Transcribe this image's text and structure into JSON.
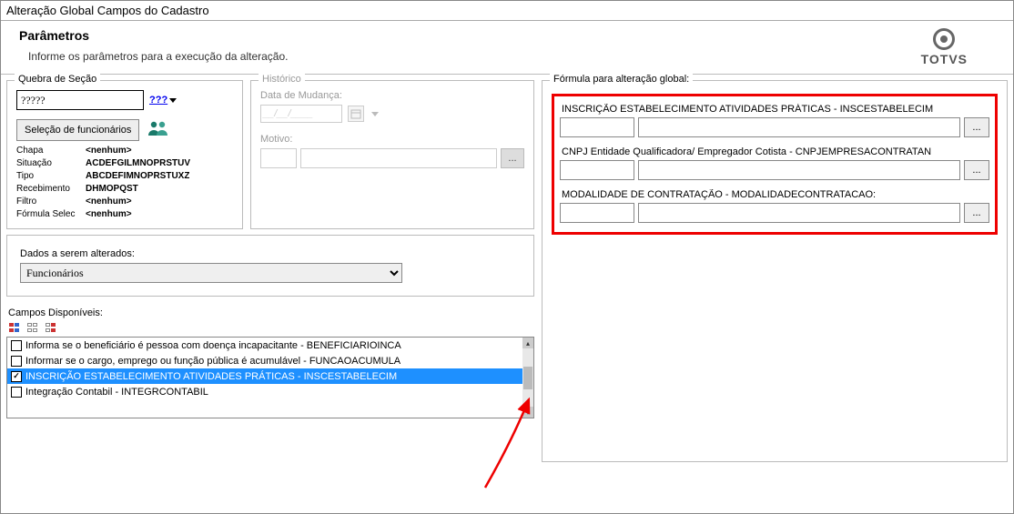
{
  "window": {
    "title": "Alteração Global Campos do Cadastro"
  },
  "header": {
    "title": "Parâmetros",
    "subtitle": "Informe os parâmetros para a execução da alteração.",
    "brand": "TOTVS"
  },
  "quebra": {
    "group_label": "Quebra de Seção",
    "value": "?????",
    "help_text": "???",
    "sel_button": "Seleção de funcionários",
    "filters": [
      {
        "label": "Chapa",
        "value": "<nenhum>"
      },
      {
        "label": "Situação",
        "value": "ACDEFGILMNOPRSTUV"
      },
      {
        "label": "Tipo",
        "value": "ABCDEFIMNOPRSTUXZ"
      },
      {
        "label": "Recebimento",
        "value": "DHMOPQST"
      },
      {
        "label": "Filtro",
        "value": "<nenhum>"
      },
      {
        "label": "Fórmula Selec",
        "value": "<nenhum>"
      }
    ]
  },
  "historico": {
    "group_label": "Histórico",
    "data_label": "Data de Mudança:",
    "data_placeholder": "__/__/____",
    "motivo_label": "Motivo:",
    "browse": "..."
  },
  "dados": {
    "label": "Dados a serem alterados:",
    "selected": "Funcionários"
  },
  "campos": {
    "label": "Campos Disponíveis:",
    "items": [
      {
        "checked": false,
        "text": "Informa se o beneficiário é pessoa com doença incapacitante - BENEFICIARIOINCA"
      },
      {
        "checked": false,
        "text": "Informar se o cargo, emprego ou função pública é acumulável - FUNCAOACUMULA"
      },
      {
        "checked": true,
        "selected": true,
        "text": "INSCRIÇÃO ESTABELECIMENTO ATIVIDADES PRÁTICAS - INSCESTABELECIM"
      },
      {
        "checked": false,
        "text": "Integração Contabil - INTEGRCONTABIL"
      }
    ]
  },
  "formula": {
    "group_label": "Fórmula para alteração global:",
    "blocks": [
      {
        "label": "INSCRIÇÃO ESTABELECIMENTO ATIVIDADES PRÁTICAS - INSCESTABELECIM"
      },
      {
        "label": "CNPJ Entidade Qualificadora/ Empregador Cotista - CNPJEMPRESACONTRATAN"
      },
      {
        "label": "MODALIDADE DE CONTRATAÇÃO - MODALIDADECONTRATACAO:"
      }
    ],
    "browse": "..."
  }
}
